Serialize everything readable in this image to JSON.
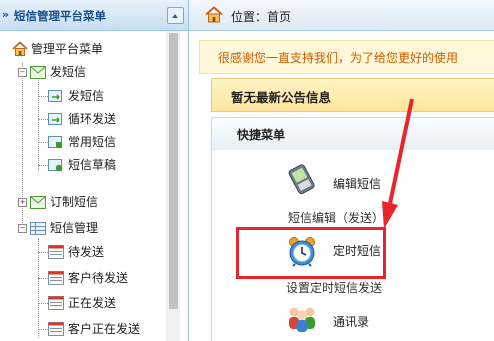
{
  "sidebar": {
    "header_arrows": "»",
    "title": "短信管理平台菜单",
    "tree": {
      "root": "管理平台菜单",
      "groups": [
        {
          "label": "发短信",
          "expanded": true,
          "items": [
            "发短信",
            "循环发送",
            "常用短信",
            "短信草稿"
          ]
        },
        {
          "label": "订制短信",
          "expanded": false,
          "items": []
        },
        {
          "label": "短信管理",
          "expanded": true,
          "items": [
            "待发送",
            "客户待发送",
            "正在发送",
            "客户正在发送"
          ]
        }
      ]
    },
    "expand_symbol_open": "−",
    "expand_symbol_closed": "+"
  },
  "location": {
    "label": "位置：首页"
  },
  "banner": {
    "thanks_text": "很感谢您一直支持我们，为了给您更好的使用"
  },
  "notice": {
    "title": "暂无最新公告信息"
  },
  "quick_menu": {
    "title": "快捷菜单",
    "items": [
      {
        "label": "编辑短信",
        "description": "短信编辑（发送）",
        "icon": "phone-icon"
      },
      {
        "label": "定时短信",
        "description": "设置定时短信发送",
        "icon": "alarm-clock-icon"
      },
      {
        "label": "通讯录",
        "description": "",
        "icon": "people-icon"
      }
    ]
  },
  "colors": {
    "annotation_red": "#e8252b",
    "sidebar_title": "#1b4f8a",
    "thanks_text": "#d05b00"
  }
}
